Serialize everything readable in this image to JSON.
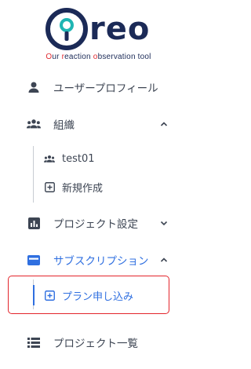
{
  "brand": {
    "logo_text": "reo",
    "logo_mark": "O",
    "tagline_segments": [
      {
        "text": "O",
        "accent": true
      },
      {
        "text": "ur ",
        "accent": false
      },
      {
        "text": "r",
        "accent": true
      },
      {
        "text": "eaction ",
        "accent": false
      },
      {
        "text": "o",
        "accent": true
      },
      {
        "text": "bservation tool",
        "accent": false
      }
    ]
  },
  "menu": {
    "user_profile": {
      "label": "ユーザープロフィール",
      "icon": "person-icon"
    },
    "organization": {
      "label": "組織",
      "icon": "group-icon",
      "expanded": true,
      "children": [
        {
          "label": "test01",
          "icon": "group-small-icon"
        },
        {
          "label": "新規作成",
          "icon": "plus-box-icon"
        }
      ]
    },
    "project_settings": {
      "label": "プロジェクト設定",
      "icon": "bar-chart-icon",
      "expanded": false
    },
    "subscription": {
      "label": "サブスクリプション",
      "icon": "card-icon",
      "expanded": true,
      "active": true,
      "children": [
        {
          "label": "プラン申し込み",
          "icon": "plus-box-icon",
          "active": true
        }
      ]
    },
    "project_list": {
      "label": "プロジェクト一覧",
      "icon": "list-icon"
    }
  },
  "colors": {
    "brand_navy": "#1b2a57",
    "brand_teal": "#1fb5b3",
    "accent_red": "#e0292f",
    "active_blue": "#2f6fe0",
    "icon_gray": "#3d4553"
  }
}
